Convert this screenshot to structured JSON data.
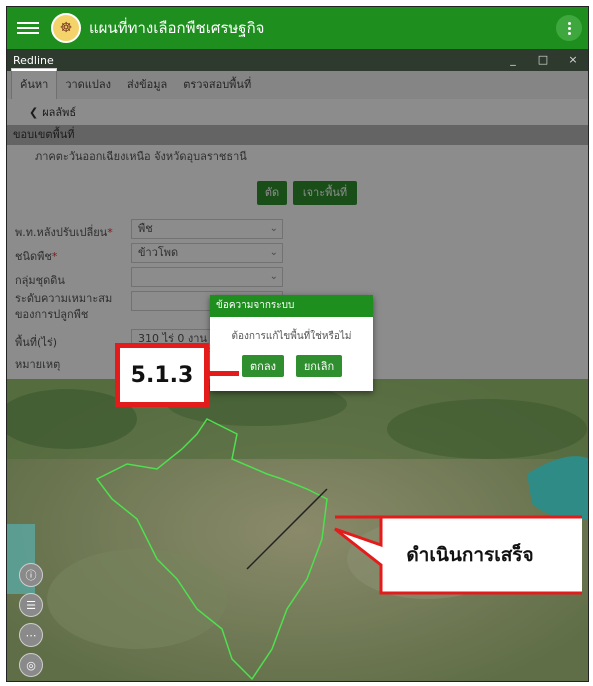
{
  "app": {
    "title": "แผนที่ทางเลือกพืชเศรษฐกิจ"
  },
  "window": {
    "title": "Redline",
    "controls": [
      "_",
      "□",
      "×"
    ]
  },
  "tabs": [
    {
      "label": "ค้นหา",
      "active": true
    },
    {
      "label": "วาดแปลง",
      "active": false
    },
    {
      "label": "ส่งข้อมูล",
      "active": false
    },
    {
      "label": "ตรวจสอบพื้นที่",
      "active": false
    }
  ],
  "breadcrumb": {
    "back_label": "ผลลัพธ์"
  },
  "section": {
    "title": "ขอบเขตพื้นที่"
  },
  "area_text": "ภาคตะวันออกเฉียงเหนือ จังหวัดอุบลราชธานี",
  "buttons": {
    "cut": "ตัด",
    "drill": "เจาะพื้นที่"
  },
  "form": {
    "crop_group_label": "พ.ท.หลังปรับเปลี่ยน",
    "crop_group_value": "พืช",
    "crop_type_label": "ชนิดพืช",
    "crop_type_value": "ข้าวโพด",
    "soil_group_label": "กลุ่มชุดดิน",
    "soil_group_value": "",
    "suitability_label": "ระดับความเหมาะสมของการปลูกพืช",
    "area_label": "พื้นที่(ไร่)",
    "area_value": "310 ไร่ 0 งาน 5 ต",
    "note_label": "หมายเหตุ"
  },
  "dialog": {
    "title": "ข้อความจากระบบ",
    "message": "ต้องการแก้ไขพื้นที่ใช่หรือไม่",
    "ok_label": "ตกลง",
    "cancel_label": "ยกเลิก"
  },
  "annotations": {
    "step_label": "5.1.3",
    "done_label": "ดำเนินการเสร็จ"
  },
  "colors": {
    "brand_green": "#1e8f1e",
    "button_green": "#2f8f2f",
    "callout_red": "#e31b1b",
    "parcel_outline": "#4ee04e"
  }
}
